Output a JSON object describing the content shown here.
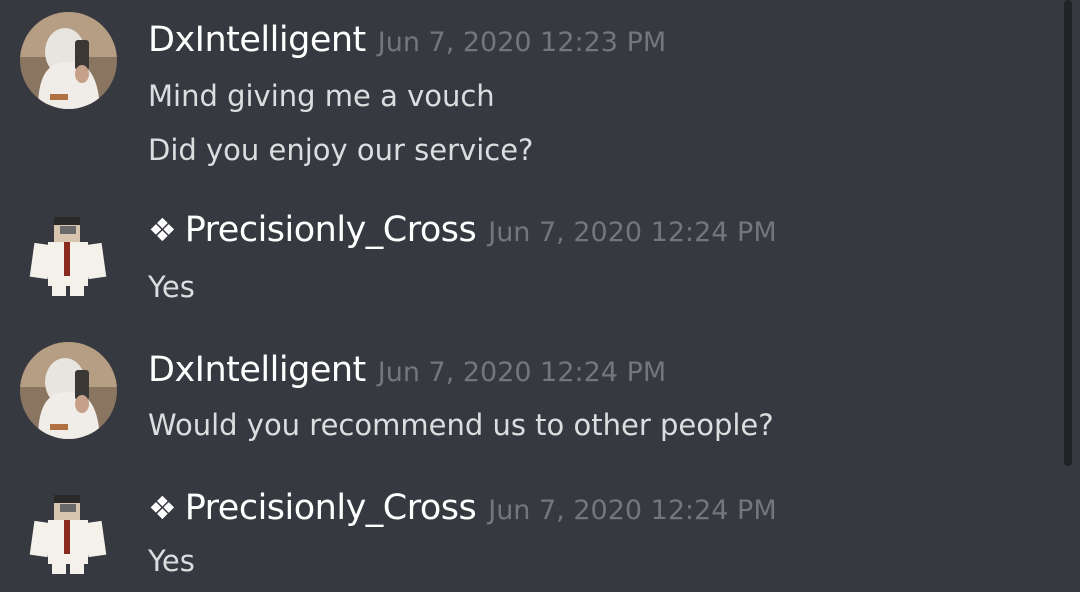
{
  "messages": [
    {
      "author": "DxIntelligent",
      "timestamp": "Jun 7, 2020 12:23 PM",
      "lines": [
        "Mind giving me a vouch",
        "Did you enjoy our service?"
      ]
    },
    {
      "author": "Precisionly_Cross",
      "badge": "❖",
      "timestamp": "Jun 7, 2020 12:24 PM",
      "lines": [
        "Yes"
      ]
    },
    {
      "author": "DxIntelligent",
      "timestamp": "Jun 7, 2020 12:24 PM",
      "lines": [
        "Would you recommend us to other people?"
      ]
    },
    {
      "author": "Precisionly_Cross",
      "badge": "❖",
      "timestamp": "Jun 7, 2020 12:24 PM",
      "lines": [
        "Yes"
      ]
    }
  ],
  "colors": {
    "background": "#36393f",
    "username": "#ffffff",
    "message_text": "#dcddde",
    "timestamp": "#72767d",
    "scrollbar": "#202225"
  }
}
